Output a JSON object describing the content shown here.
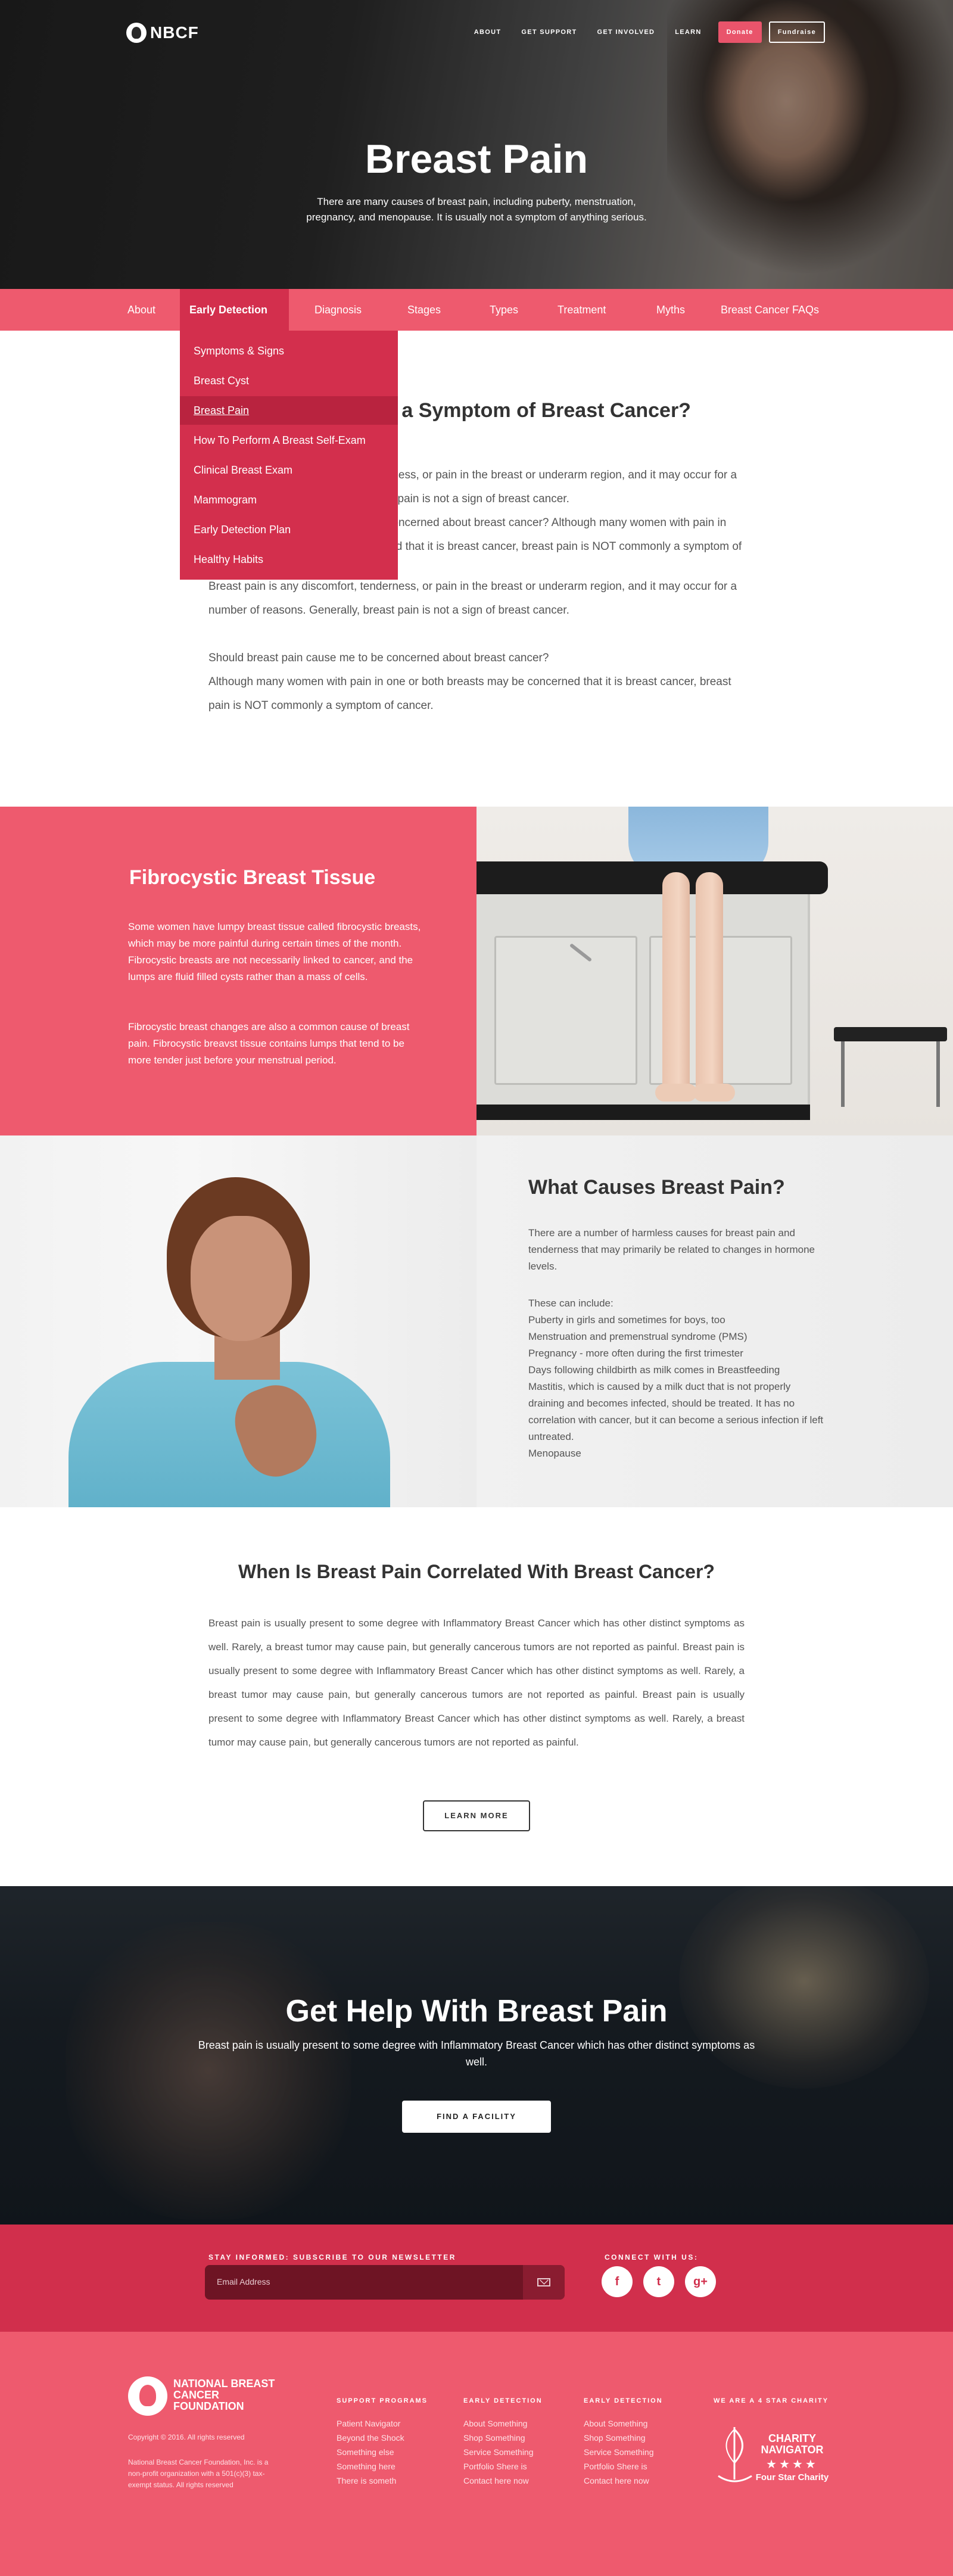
{
  "header": {
    "logo": "NBCF",
    "nav": [
      "About",
      "Get Support",
      "Get Involved",
      "Learn"
    ],
    "donate": "Donate",
    "fundraise": "Fundraise"
  },
  "hero": {
    "title": "Breast Pain",
    "subtitle": "There are many causes of breast pain, including puberty, menstruation, pregnancy, and menopause. It is usually not a symptom of anything serious."
  },
  "subnav": {
    "items": [
      "About",
      "Early Detection",
      "Diagnosis",
      "Stages",
      "Types",
      "Treatment",
      "Myths",
      "Breast Cancer FAQs"
    ],
    "active": "Early Detection"
  },
  "dropdown": {
    "items": [
      "Symptoms & Signs",
      "Breast Cyst",
      "Breast Pain",
      "How To Perform A Breast Self-Exam",
      "Clinical Breast Exam",
      "Mammogram",
      "Early Detection Plan",
      "Healthy Habits"
    ],
    "active": "Breast Pain"
  },
  "intro": {
    "title": "Is Breast Pain a Symptom of Breast Cancer?",
    "p1": "Breast pain is any discomfort, tenderness, or pain in the breast or underarm region, and it may occur for a number of reasons. Generally, breast pain is not a sign of breast cancer.",
    "p2": "Should breast pain cause me to be concerned about breast cancer? Although many women with pain in one or both breasts may be concerned that it is breast cancer, breast pain is NOT commonly a symptom of cancer.",
    "p3": "Breast pain is any discomfort, tenderness, or pain in the breast or underarm region, and it may occur for a number of reasons. Generally, breast pain is not a sign of breast cancer.",
    "p4a": "Should breast pain cause me to be concerned about breast cancer?",
    "p4b": "Although many women with pain in one or both breasts may be concerned that it is breast cancer, breast pain is NOT commonly a symptom of cancer."
  },
  "fibro": {
    "title": "Fibrocystic Breast Tissue",
    "p1": "Some women have lumpy breast tissue called fibrocystic breasts, which may be more painful during certain times of the month. Fibrocystic breasts are not necessarily linked to cancer, and the lumps are fluid filled cysts rather than a mass of cells.",
    "p2": "Fibrocystic breast changes are also a common cause of breast pain. Fibrocystic breavst tissue contains lumps that tend to be more tender just before your menstrual period."
  },
  "causes": {
    "title": "What Causes Breast Pain?",
    "lead": "There are a number of harmless causes for breast pain and tenderness that may primarily be related to changes in hormone levels.",
    "list": [
      "These can include:",
      "Puberty in girls and sometimes for boys, too",
      "Menstruation and premenstrual syndrome (PMS)",
      "Pregnancy - more often during the first trimester",
      "Days following childbirth as milk comes in Breastfeeding",
      "Mastitis, which is caused by a milk duct that is not properly draining and becomes infected, should be treated. It has no correlation with cancer, but it can become a serious infection if left untreated.",
      "Menopause"
    ]
  },
  "correlated": {
    "title": "When Is Breast Pain Correlated With Breast Cancer?",
    "text": "Breast pain is usually present to some degree with Inflammatory Breast Cancer which has other distinct symptoms as well. Rarely, a breast tumor may cause pain, but generally cancerous tumors are not reported as painful. Breast pain is usually present to some degree with Inflammatory Breast Cancer which has other distinct symptoms as well. Rarely, a breast tumor may cause pain, but generally cancerous tumors are not reported as painful. Breast pain is usually present to some degree with Inflammatory Breast Cancer which has other distinct symptoms as well. Rarely, a breast tumor may cause pain, but generally cancerous tumors are not reported as painful.",
    "button": "Learn More"
  },
  "help": {
    "title": "Get Help With Breast Pain",
    "text": "Breast pain is usually present to some degree with Inflammatory Breast Cancer which has other distinct symptoms as well.",
    "button": "Find A Facility"
  },
  "newsletter": {
    "label": "Stay Informed: Subscribe To Our Newsletter",
    "placeholder": "Email Address",
    "connect": "Connect With Us:",
    "social": [
      {
        "name": "facebook-icon",
        "glyph": "f"
      },
      {
        "name": "twitter-icon",
        "glyph": "t"
      },
      {
        "name": "google-plus-icon",
        "glyph": "g+"
      }
    ]
  },
  "footer": {
    "logo": "National Breast Cancer Foundation",
    "copyright": "Copyright © 2016. All rights reserved",
    "legal": "National Breast Cancer Foundation, Inc. is a non-profit organization with a 501(c)(3) tax-exempt status. All rights reserved",
    "columns": [
      {
        "title": "Support Programs",
        "items": [
          "Patient Navigator",
          "Beyond the Shock",
          "Something else",
          "Something here",
          "There is someth"
        ]
      },
      {
        "title": "Early Detection",
        "items": [
          "About Something",
          "Shop Something",
          "Service Something",
          "Portfolio Shere is",
          "Contact here now"
        ]
      },
      {
        "title": "Early Detection",
        "items": [
          "About Something",
          "Shop Something",
          "Service Something",
          "Portfolio Shere is",
          "Contact here now"
        ]
      }
    ],
    "star_title": "We Are A 4 Star Charity",
    "badge_name": "Charity Navigator",
    "badge_stars": "★★★★",
    "badge_rating": "Four Star Charity"
  },
  "colors": {
    "brand_pink": "#ee5a6e",
    "brand_red": "#d32f4d",
    "dark": "#333333"
  }
}
